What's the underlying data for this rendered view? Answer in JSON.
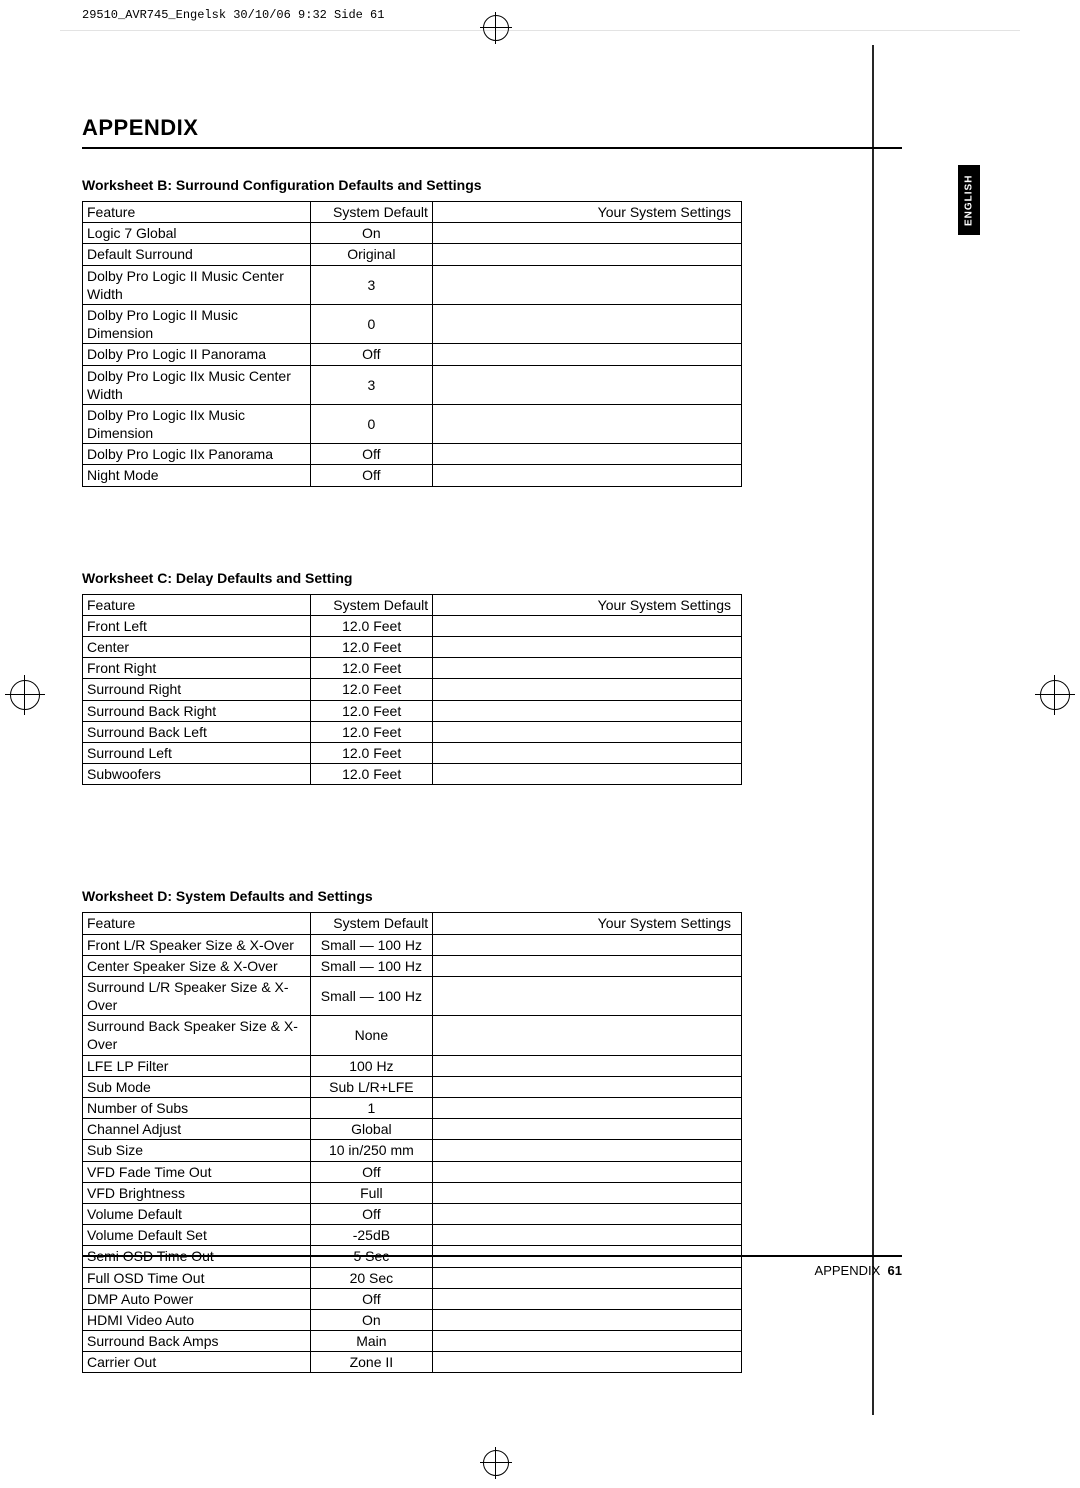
{
  "print_meta": "29510_AVR745_Engelsk  30/10/06  9:32  Side 61",
  "section_heading": "APPENDIX",
  "side_tab": "ENGLISH",
  "footer_label": "APPENDIX",
  "footer_page": "61",
  "table_headers": {
    "feature": "Feature",
    "default": "System Default",
    "settings": "Your System Settings"
  },
  "worksheet_b": {
    "title": "Worksheet B: Surround Configuration Defaults and Settings",
    "rows": [
      {
        "feature": "Logic 7 Global",
        "default": "On"
      },
      {
        "feature": "Default Surround",
        "default": "Original"
      },
      {
        "feature": "Dolby Pro Logic II Music Center Width",
        "default": "3"
      },
      {
        "feature": "Dolby Pro Logic II Music Dimension",
        "default": "0"
      },
      {
        "feature": "Dolby Pro Logic II Panorama",
        "default": "Off"
      },
      {
        "feature": "Dolby Pro Logic IIx Music Center Width",
        "default": "3"
      },
      {
        "feature": "Dolby Pro Logic IIx Music Dimension",
        "default": "0"
      },
      {
        "feature": "Dolby Pro Logic IIx Panorama",
        "default": "Off"
      },
      {
        "feature": "Night Mode",
        "default": "Off"
      }
    ]
  },
  "worksheet_c": {
    "title": "Worksheet C: Delay Defaults and Setting",
    "rows": [
      {
        "feature": "Front Left",
        "default": "12.0 Feet"
      },
      {
        "feature": "Center",
        "default": "12.0 Feet"
      },
      {
        "feature": "Front Right",
        "default": "12.0 Feet"
      },
      {
        "feature": "Surround Right",
        "default": "12.0 Feet"
      },
      {
        "feature": "Surround Back Right",
        "default": "12.0 Feet"
      },
      {
        "feature": "Surround Back Left",
        "default": "12.0 Feet"
      },
      {
        "feature": "Surround Left",
        "default": "12.0 Feet"
      },
      {
        "feature": "Subwoofers",
        "default": "12.0 Feet"
      }
    ]
  },
  "worksheet_d": {
    "title": "Worksheet D: System Defaults and Settings",
    "rows": [
      {
        "feature": "Front L/R Speaker Size & X-Over",
        "default": "Small — 100 Hz"
      },
      {
        "feature": "Center Speaker Size & X-Over",
        "default": "Small — 100 Hz"
      },
      {
        "feature": "Surround L/R Speaker Size & X-Over",
        "default": "Small — 100 Hz"
      },
      {
        "feature": "Surround Back Speaker Size & X-Over",
        "default": "None"
      },
      {
        "feature": "LFE LP Filter",
        "default": "100 Hz"
      },
      {
        "feature": "Sub Mode",
        "default": "Sub L/R+LFE"
      },
      {
        "feature": "Number of Subs",
        "default": "1"
      },
      {
        "feature": "Channel Adjust",
        "default": "Global"
      },
      {
        "feature": "Sub Size",
        "default": "10 in/250 mm"
      },
      {
        "feature": "VFD Fade Time Out",
        "default": "Off"
      },
      {
        "feature": "VFD Brightness",
        "default": "Full"
      },
      {
        "feature": "Volume Default",
        "default": "Off"
      },
      {
        "feature": "Volume Default Set",
        "default": "-25dB"
      },
      {
        "feature": "Semi OSD Time Out",
        "default": "5 Sec"
      },
      {
        "feature": "Full OSD Time Out",
        "default": "20 Sec"
      },
      {
        "feature": "DMP Auto Power",
        "default": "Off"
      },
      {
        "feature": "HDMI Video Auto",
        "default": "On"
      },
      {
        "feature": "Surround Back Amps",
        "default": "Main"
      },
      {
        "feature": "Carrier Out",
        "default": "Zone II"
      }
    ]
  }
}
